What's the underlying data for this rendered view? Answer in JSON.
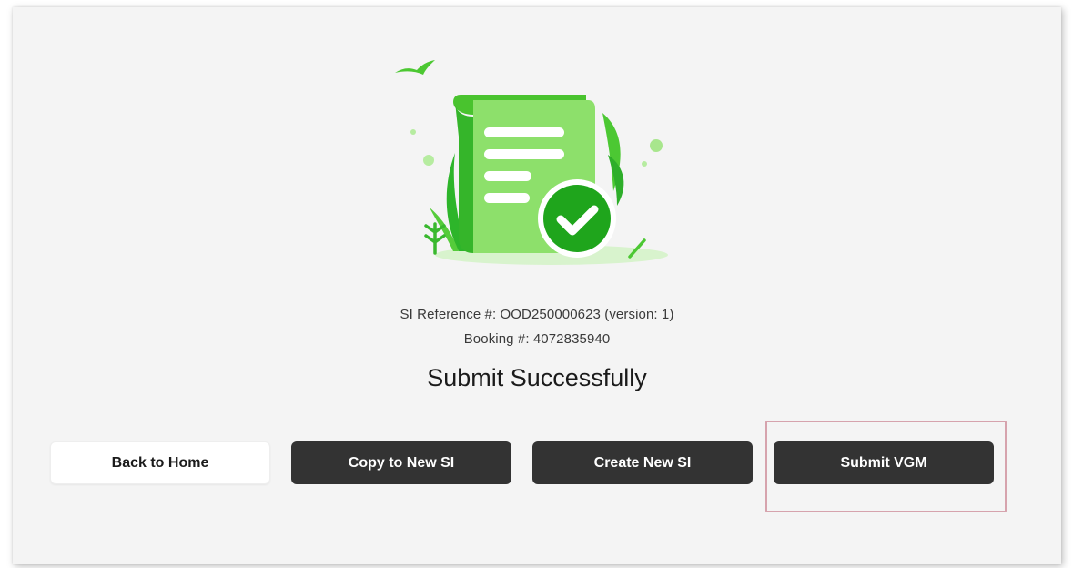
{
  "confirmation": {
    "si_reference": "SI Reference #: OOD250000623 (version: 1)",
    "booking": "Booking #: 4072835940",
    "headline": "Submit Successfully"
  },
  "actions": {
    "back_home": "Back to Home",
    "copy_new_si": "Copy to New SI",
    "create_new_si": "Create New SI",
    "submit_vgm": "Submit VGM"
  },
  "icons": {
    "illustration": "document-success-icon",
    "check": "check-icon"
  },
  "colors": {
    "accent_green": "#3fca2a",
    "light_green": "#8ee66d",
    "button_dark": "#333333",
    "highlight": "#d6a3ad"
  }
}
